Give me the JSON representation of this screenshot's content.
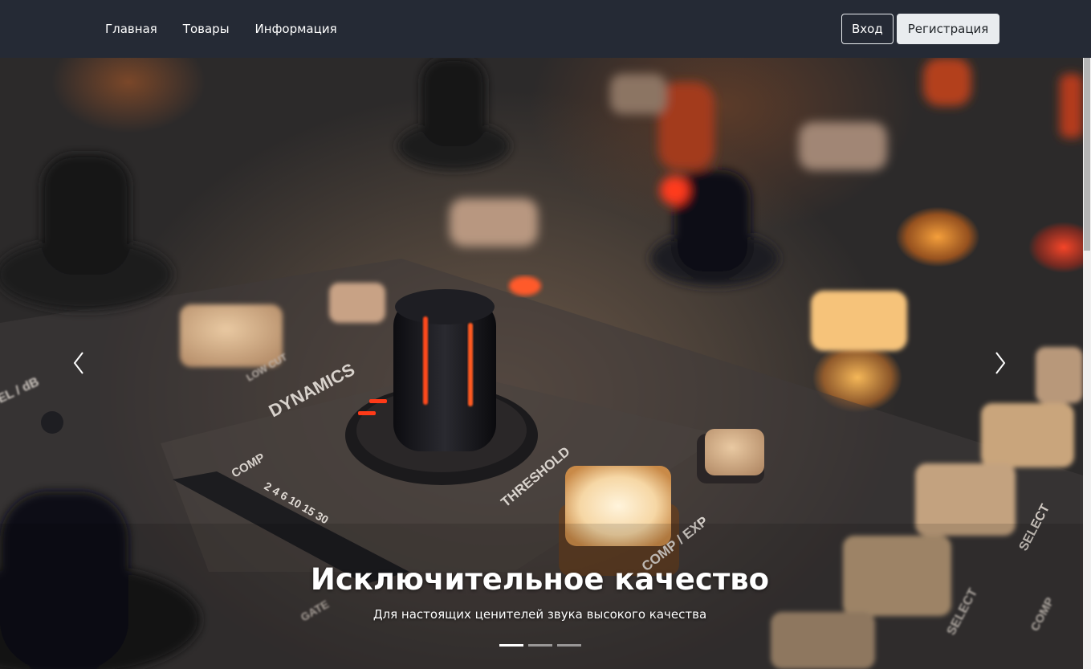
{
  "navbar": {
    "links": [
      "Главная",
      "Товары",
      "Информация"
    ],
    "login_label": "Вход",
    "register_label": "Регистрация"
  },
  "carousel": {
    "slides_count": 3,
    "active_index": 0,
    "slide": {
      "title": "Исключительное качество",
      "subtitle": "Для настоящих ценителей звука высокого качества",
      "image_text": {
        "dynamics": "DYNAMICS",
        "threshold": "THRESHOLD",
        "comp_exp": "COMP / EXP",
        "comp": "COMP",
        "low_cut": "LOW CUT",
        "select": "SELECT",
        "select2": "SELECT",
        "comp2": "COMP",
        "gate": "GATE",
        "el_db": "EL / dB",
        "scale": "2 4 6 10 15 30"
      }
    },
    "prev_icon": "chevron-left-icon",
    "next_icon": "chevron-right-icon"
  },
  "colors": {
    "navbar_bg": "#252a35",
    "register_bg": "#e9ecef",
    "text_light": "#ffffff"
  }
}
